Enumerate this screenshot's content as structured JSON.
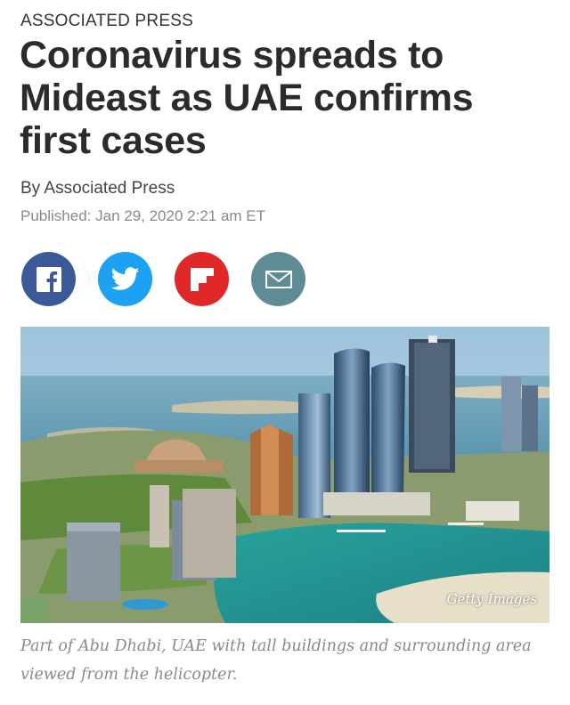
{
  "article": {
    "kicker": "ASSOCIATED PRESS",
    "headline": "Coronavirus spreads to Mideast as UAE confirms first cases",
    "byline": "By Associated Press",
    "published": "Published: Jan 29, 2020 2:21 am ET"
  },
  "share": {
    "buttons": [
      {
        "name": "facebook",
        "icon": "facebook-icon",
        "color": "#3b5998"
      },
      {
        "name": "twitter",
        "icon": "twitter-icon",
        "color": "#1da1f2"
      },
      {
        "name": "flipboard",
        "icon": "flipboard-icon",
        "color": "#e12828"
      },
      {
        "name": "email",
        "icon": "email-icon",
        "color": "#5f8b95"
      }
    ]
  },
  "image": {
    "credit": "Getty Images",
    "caption": "Part of Abu Dhabi, UAE with tall buildings and surrounding area viewed from the helicopter."
  }
}
